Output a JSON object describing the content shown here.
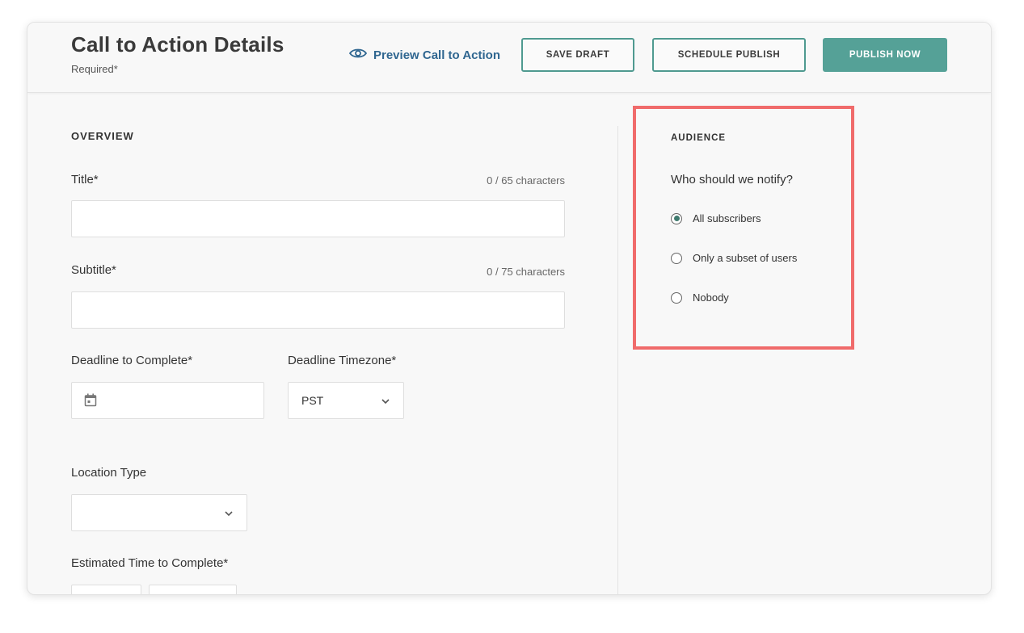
{
  "header": {
    "title": "Call to Action Details",
    "required_note": "Required*",
    "preview_label": "Preview Call to Action",
    "save_draft_label": "SAVE DRAFT",
    "schedule_label": "SCHEDULE PUBLISH",
    "publish_label": "PUBLISH NOW"
  },
  "overview": {
    "section_label": "OVERVIEW",
    "title_label": "Title*",
    "title_counter": "0 / 65 characters",
    "title_value": "",
    "subtitle_label": "Subtitle*",
    "subtitle_counter": "0 / 75 characters",
    "subtitle_value": "",
    "deadline_label": "Deadline to Complete*",
    "deadline_value": "",
    "timezone_label": "Deadline Timezone*",
    "timezone_value": "PST",
    "location_label": "Location Type",
    "location_value": "",
    "estimated_label": "Estimated Time to Complete*"
  },
  "audience": {
    "section_label": "AUDIENCE",
    "question": "Who should we notify?",
    "options": [
      {
        "label": "All subscribers",
        "selected": true
      },
      {
        "label": "Only a subset of users",
        "selected": false
      },
      {
        "label": "Nobody",
        "selected": false
      }
    ]
  },
  "colors": {
    "accent": "#55a197",
    "link": "#2f6690",
    "highlight_border": "#f06b6b"
  },
  "icons": [
    "eye-icon",
    "calendar-icon",
    "chevron-down-icon"
  ]
}
